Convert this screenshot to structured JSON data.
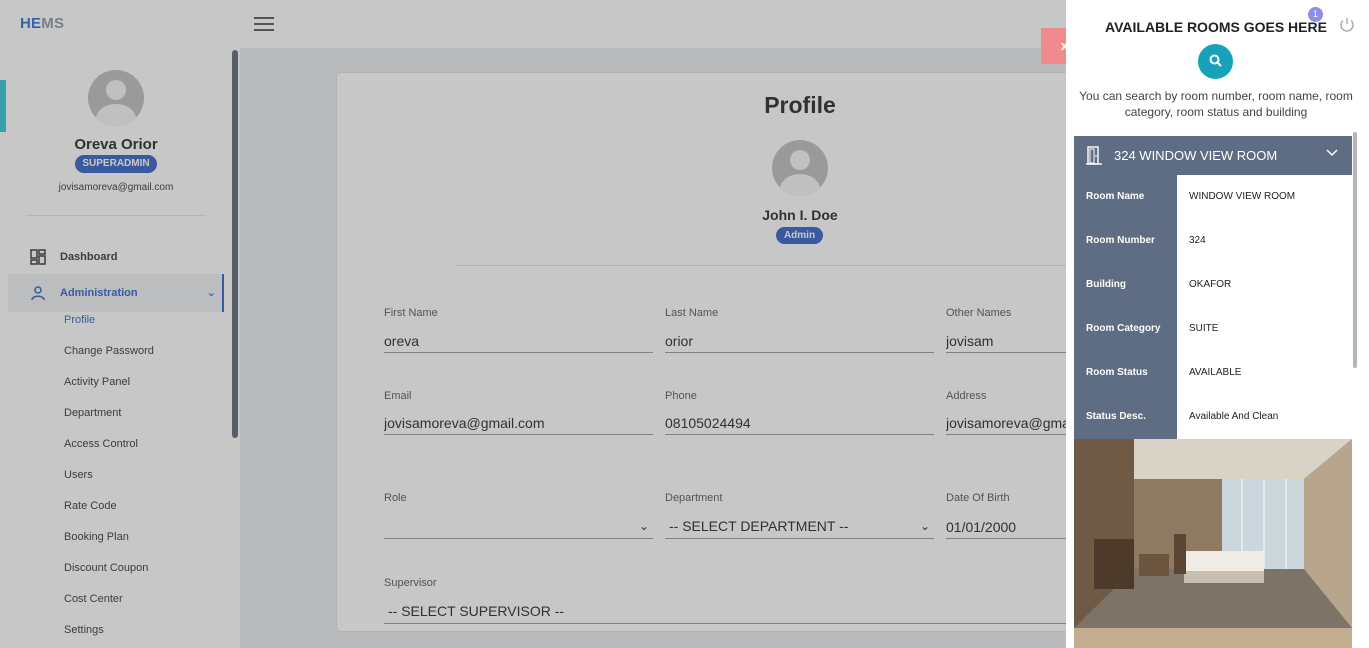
{
  "app": {
    "logo_he": "HE",
    "logo_ms": "MS"
  },
  "sidebar": {
    "user_name": "Oreva Orior",
    "role": "SUPERADMIN",
    "email": "jovisamoreva@gmail.com",
    "nav": {
      "dashboard": "Dashboard",
      "administration": "Administration"
    },
    "sub_items": [
      "Profile",
      "Change Password",
      "Activity Panel",
      "Department",
      "Access Control",
      "Users",
      "Rate Code",
      "Booking Plan",
      "Discount Coupon",
      "Cost Center",
      "Settings"
    ]
  },
  "profile": {
    "title": "Profile",
    "card_name": "John I. Doe",
    "card_role": "Admin",
    "fields": {
      "first_name_label": "First Name",
      "first_name": "oreva",
      "last_name_label": "Last Name",
      "last_name": "orior",
      "other_names_label": "Other Names",
      "other_names": "jovisam",
      "email_label": "Email",
      "email": "jovisamoreva@gmail.com",
      "phone_label": "Phone",
      "phone": "08105024494",
      "address_label": "Address",
      "address": "jovisamoreva@gmai",
      "role_label": "Role",
      "role": "",
      "department_label": "Department",
      "department": "-- SELECT DEPARTMENT --",
      "dob_label": "Date Of Birth",
      "dob": "01/01/2000",
      "supervisor_label": "Supervisor",
      "supervisor": "-- SELECT SUPERVISOR --"
    }
  },
  "overlay": {
    "close_label": "x"
  },
  "panel": {
    "title": "AVAILABLE ROOMS GOES HERE",
    "notif_count": "1",
    "search_hint": "You can search by room number, room name, room category, room status and building",
    "room": {
      "header": "324 WINDOW VIEW ROOM",
      "rows": [
        {
          "key": "Room Name",
          "value": "WINDOW VIEW ROOM"
        },
        {
          "key": "Room Number",
          "value": "324"
        },
        {
          "key": "Building",
          "value": "OKAFOR"
        },
        {
          "key": "Room Category",
          "value": "SUITE"
        },
        {
          "key": "Room Status",
          "value": "AVAILABLE"
        },
        {
          "key": "Status Desc.",
          "value": "Available And Clean"
        }
      ]
    }
  }
}
